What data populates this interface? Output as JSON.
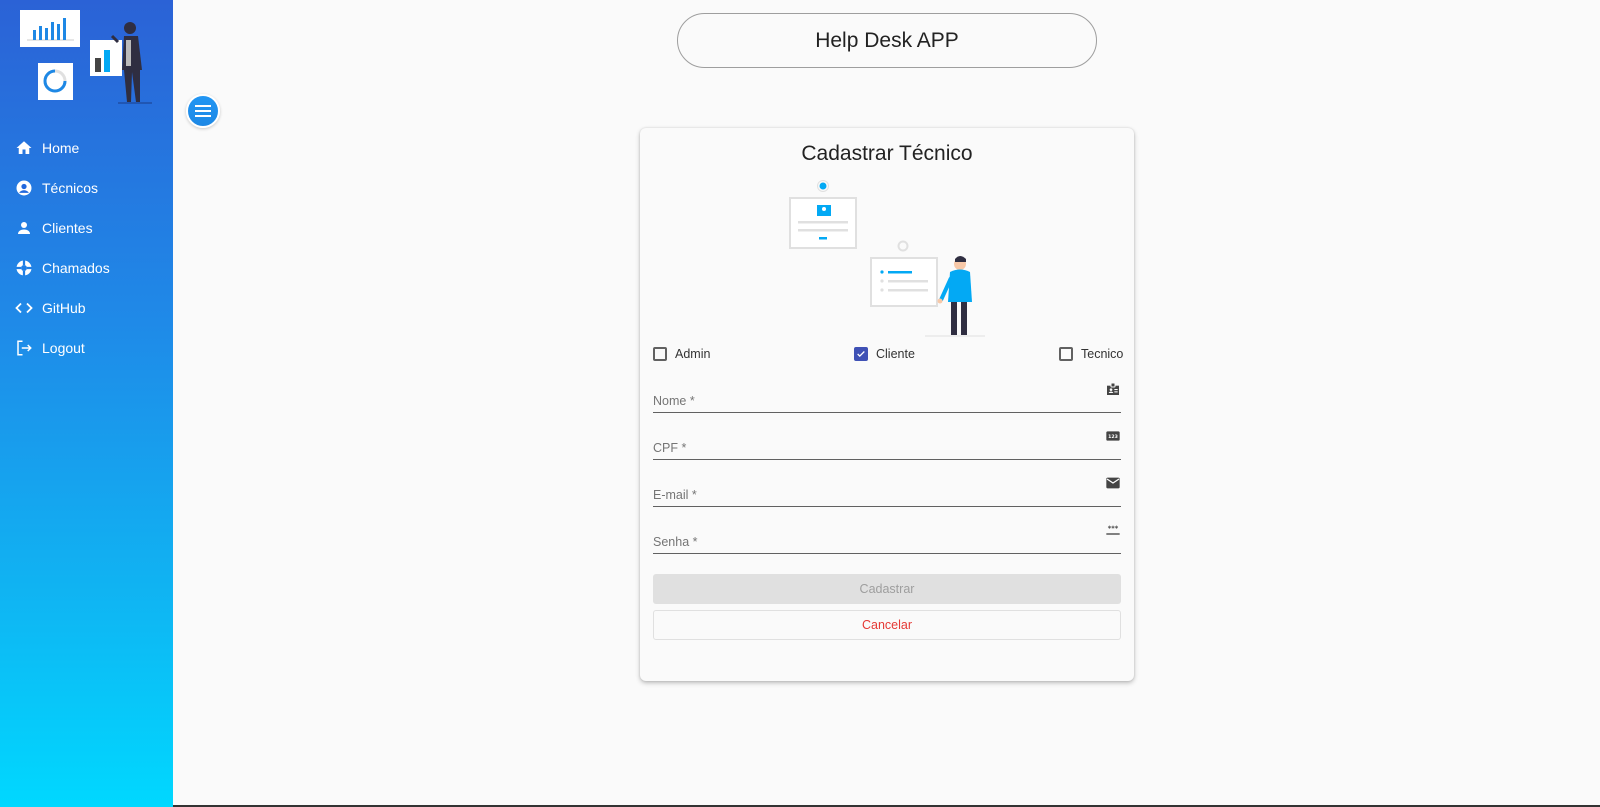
{
  "header": {
    "title": "Help Desk APP"
  },
  "sidebar": {
    "items": [
      {
        "label": "Home",
        "icon": "home-icon"
      },
      {
        "label": "Técnicos",
        "icon": "account-circle-icon"
      },
      {
        "label": "Clientes",
        "icon": "person-icon"
      },
      {
        "label": "Chamados",
        "icon": "support-icon"
      },
      {
        "label": "GitHub",
        "icon": "code-icon"
      },
      {
        "label": "Logout",
        "icon": "logout-icon"
      }
    ]
  },
  "form": {
    "title": "Cadastrar Técnico",
    "profiles": [
      {
        "label": "Admin",
        "checked": false
      },
      {
        "label": "Cliente",
        "checked": true
      },
      {
        "label": "Tecnico",
        "checked": false
      }
    ],
    "fields": {
      "nome": {
        "placeholder": "Nome *",
        "icon": "badge-icon"
      },
      "cpf": {
        "placeholder": "CPF *",
        "icon": "numbers-icon"
      },
      "email": {
        "placeholder": "E-mail *",
        "icon": "mail-icon"
      },
      "senha": {
        "placeholder": "Senha *",
        "icon": "password-icon"
      }
    },
    "submit_label": "Cadastrar",
    "cancel_label": "Cancelar"
  },
  "colors": {
    "sidebar_gradient_top": "#2b62d6",
    "sidebar_gradient_bottom": "#00d8ff",
    "checkbox_checked": "#3f51b5",
    "cancel_text": "#e53935",
    "illustration_accent": "#03a9f4"
  }
}
